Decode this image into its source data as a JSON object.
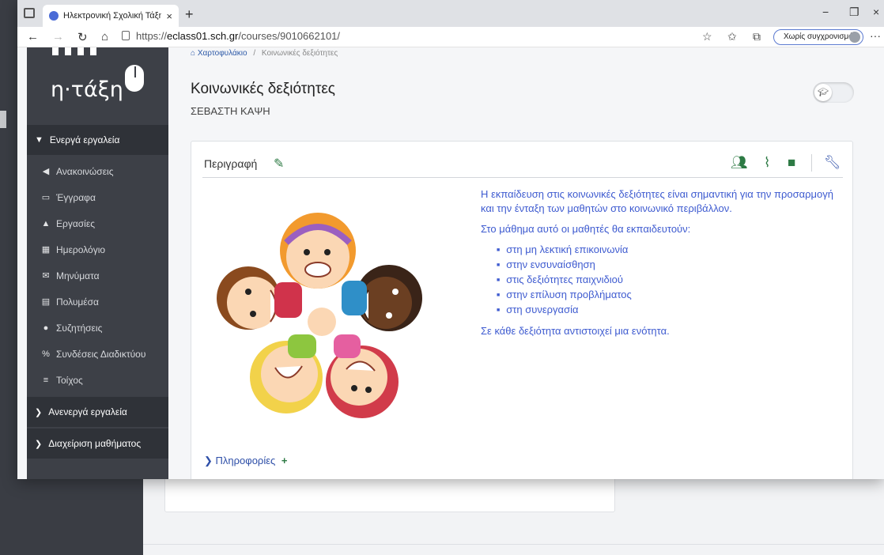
{
  "browser": {
    "tab_title": "Ηλεκτρονική Σχολική Τάξη (η-Τά",
    "tab_close": "×",
    "new_tab": "+",
    "url_prefix": "https://",
    "url_host": "eclass01.sch.gr",
    "url_path": "/courses/9010662101/",
    "sync_label": "Χωρίς συγχρονισμό",
    "minimize": "−",
    "maximize": "❐",
    "close": "×",
    "more": "···"
  },
  "logo": {
    "text": "η·τάξη"
  },
  "sidebar": {
    "active_tools_label": "Ενεργά εργαλεία",
    "items": [
      {
        "label": "Ανακοινώσεις",
        "icon": "megaphone-icon",
        "glyph": "◀"
      },
      {
        "label": "Έγγραφα",
        "icon": "folder-icon",
        "glyph": "▭"
      },
      {
        "label": "Εργασίες",
        "icon": "flask-icon",
        "glyph": "▲"
      },
      {
        "label": "Ημερολόγιο",
        "icon": "calendar-icon",
        "glyph": "▦"
      },
      {
        "label": "Μηνύματα",
        "icon": "envelope-icon",
        "glyph": "✉"
      },
      {
        "label": "Πολυμέσα",
        "icon": "film-icon",
        "glyph": "▤"
      },
      {
        "label": "Συζητήσεις",
        "icon": "comments-icon",
        "glyph": "●"
      },
      {
        "label": "Συνδέσεις Διαδικτύου",
        "icon": "link-icon",
        "glyph": "%"
      },
      {
        "label": "Τοίχος",
        "icon": "list-icon",
        "glyph": "≡"
      }
    ],
    "inactive_tools_label": "Ανενεργά εργαλεία",
    "course_admin_label": "Διαχείριση μαθήματος"
  },
  "breadcrumb": {
    "home": "Χαρτοφυλάκιο",
    "separator": "/",
    "current": "Κοινωνικές δεξιότητες"
  },
  "course": {
    "title": "Κοινωνικές δεξιότητες",
    "teacher": "ΣΕΒΑΣΤΗ ΚΑΨΗ"
  },
  "card": {
    "title": "Περιγραφή",
    "intro": "Η εκπαίδευση στις κοινωνικές δεξιότητες είναι σημαντική για την προσαρμογή και την ένταξη των μαθητών στο κοινωνικό περιβάλλον.",
    "lead": "Στο μάθημα αυτό οι μαθητές θα εκπαιδευτούν:",
    "bullets": [
      "στη μη λεκτική επικοινωνία",
      "στην ενσυναίσθηση",
      "στις δεξιότητες παιχνιδιού",
      "στην επίλυση προβλήματος",
      "στη συνεργασία"
    ],
    "closing": "Σε κάθε δεξιότητα αντιστοιχεί μια ενότητα.",
    "info_label": "Πληροφορίες"
  },
  "colors": {
    "accent_text": "#3e5bd0",
    "green_icons": "#2d7a44",
    "sidebar_bg": "#3d4047"
  }
}
